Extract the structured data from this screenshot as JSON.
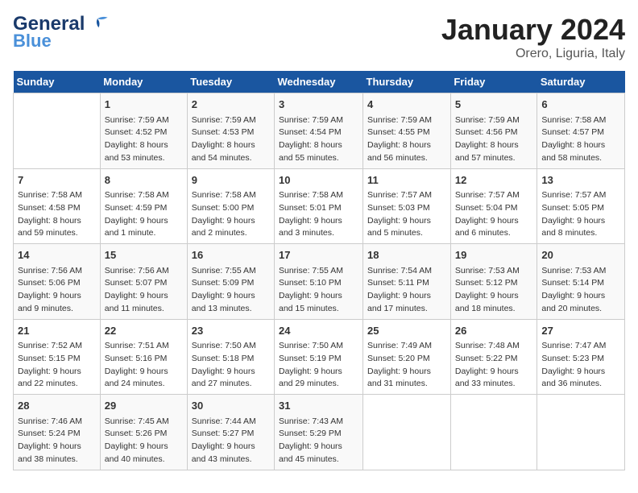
{
  "logo": {
    "part1": "General",
    "part2": "Blue"
  },
  "title": "January 2024",
  "location": "Orero, Liguria, Italy",
  "days_header": [
    "Sunday",
    "Monday",
    "Tuesday",
    "Wednesday",
    "Thursday",
    "Friday",
    "Saturday"
  ],
  "weeks": [
    [
      {
        "day": "",
        "info": ""
      },
      {
        "day": "1",
        "info": "Sunrise: 7:59 AM\nSunset: 4:52 PM\nDaylight: 8 hours\nand 53 minutes."
      },
      {
        "day": "2",
        "info": "Sunrise: 7:59 AM\nSunset: 4:53 PM\nDaylight: 8 hours\nand 54 minutes."
      },
      {
        "day": "3",
        "info": "Sunrise: 7:59 AM\nSunset: 4:54 PM\nDaylight: 8 hours\nand 55 minutes."
      },
      {
        "day": "4",
        "info": "Sunrise: 7:59 AM\nSunset: 4:55 PM\nDaylight: 8 hours\nand 56 minutes."
      },
      {
        "day": "5",
        "info": "Sunrise: 7:59 AM\nSunset: 4:56 PM\nDaylight: 8 hours\nand 57 minutes."
      },
      {
        "day": "6",
        "info": "Sunrise: 7:58 AM\nSunset: 4:57 PM\nDaylight: 8 hours\nand 58 minutes."
      }
    ],
    [
      {
        "day": "7",
        "info": "Sunrise: 7:58 AM\nSunset: 4:58 PM\nDaylight: 8 hours\nand 59 minutes."
      },
      {
        "day": "8",
        "info": "Sunrise: 7:58 AM\nSunset: 4:59 PM\nDaylight: 9 hours\nand 1 minute."
      },
      {
        "day": "9",
        "info": "Sunrise: 7:58 AM\nSunset: 5:00 PM\nDaylight: 9 hours\nand 2 minutes."
      },
      {
        "day": "10",
        "info": "Sunrise: 7:58 AM\nSunset: 5:01 PM\nDaylight: 9 hours\nand 3 minutes."
      },
      {
        "day": "11",
        "info": "Sunrise: 7:57 AM\nSunset: 5:03 PM\nDaylight: 9 hours\nand 5 minutes."
      },
      {
        "day": "12",
        "info": "Sunrise: 7:57 AM\nSunset: 5:04 PM\nDaylight: 9 hours\nand 6 minutes."
      },
      {
        "day": "13",
        "info": "Sunrise: 7:57 AM\nSunset: 5:05 PM\nDaylight: 9 hours\nand 8 minutes."
      }
    ],
    [
      {
        "day": "14",
        "info": "Sunrise: 7:56 AM\nSunset: 5:06 PM\nDaylight: 9 hours\nand 9 minutes."
      },
      {
        "day": "15",
        "info": "Sunrise: 7:56 AM\nSunset: 5:07 PM\nDaylight: 9 hours\nand 11 minutes."
      },
      {
        "day": "16",
        "info": "Sunrise: 7:55 AM\nSunset: 5:09 PM\nDaylight: 9 hours\nand 13 minutes."
      },
      {
        "day": "17",
        "info": "Sunrise: 7:55 AM\nSunset: 5:10 PM\nDaylight: 9 hours\nand 15 minutes."
      },
      {
        "day": "18",
        "info": "Sunrise: 7:54 AM\nSunset: 5:11 PM\nDaylight: 9 hours\nand 17 minutes."
      },
      {
        "day": "19",
        "info": "Sunrise: 7:53 AM\nSunset: 5:12 PM\nDaylight: 9 hours\nand 18 minutes."
      },
      {
        "day": "20",
        "info": "Sunrise: 7:53 AM\nSunset: 5:14 PM\nDaylight: 9 hours\nand 20 minutes."
      }
    ],
    [
      {
        "day": "21",
        "info": "Sunrise: 7:52 AM\nSunset: 5:15 PM\nDaylight: 9 hours\nand 22 minutes."
      },
      {
        "day": "22",
        "info": "Sunrise: 7:51 AM\nSunset: 5:16 PM\nDaylight: 9 hours\nand 24 minutes."
      },
      {
        "day": "23",
        "info": "Sunrise: 7:50 AM\nSunset: 5:18 PM\nDaylight: 9 hours\nand 27 minutes."
      },
      {
        "day": "24",
        "info": "Sunrise: 7:50 AM\nSunset: 5:19 PM\nDaylight: 9 hours\nand 29 minutes."
      },
      {
        "day": "25",
        "info": "Sunrise: 7:49 AM\nSunset: 5:20 PM\nDaylight: 9 hours\nand 31 minutes."
      },
      {
        "day": "26",
        "info": "Sunrise: 7:48 AM\nSunset: 5:22 PM\nDaylight: 9 hours\nand 33 minutes."
      },
      {
        "day": "27",
        "info": "Sunrise: 7:47 AM\nSunset: 5:23 PM\nDaylight: 9 hours\nand 36 minutes."
      }
    ],
    [
      {
        "day": "28",
        "info": "Sunrise: 7:46 AM\nSunset: 5:24 PM\nDaylight: 9 hours\nand 38 minutes."
      },
      {
        "day": "29",
        "info": "Sunrise: 7:45 AM\nSunset: 5:26 PM\nDaylight: 9 hours\nand 40 minutes."
      },
      {
        "day": "30",
        "info": "Sunrise: 7:44 AM\nSunset: 5:27 PM\nDaylight: 9 hours\nand 43 minutes."
      },
      {
        "day": "31",
        "info": "Sunrise: 7:43 AM\nSunset: 5:29 PM\nDaylight: 9 hours\nand 45 minutes."
      },
      {
        "day": "",
        "info": ""
      },
      {
        "day": "",
        "info": ""
      },
      {
        "day": "",
        "info": ""
      }
    ]
  ]
}
